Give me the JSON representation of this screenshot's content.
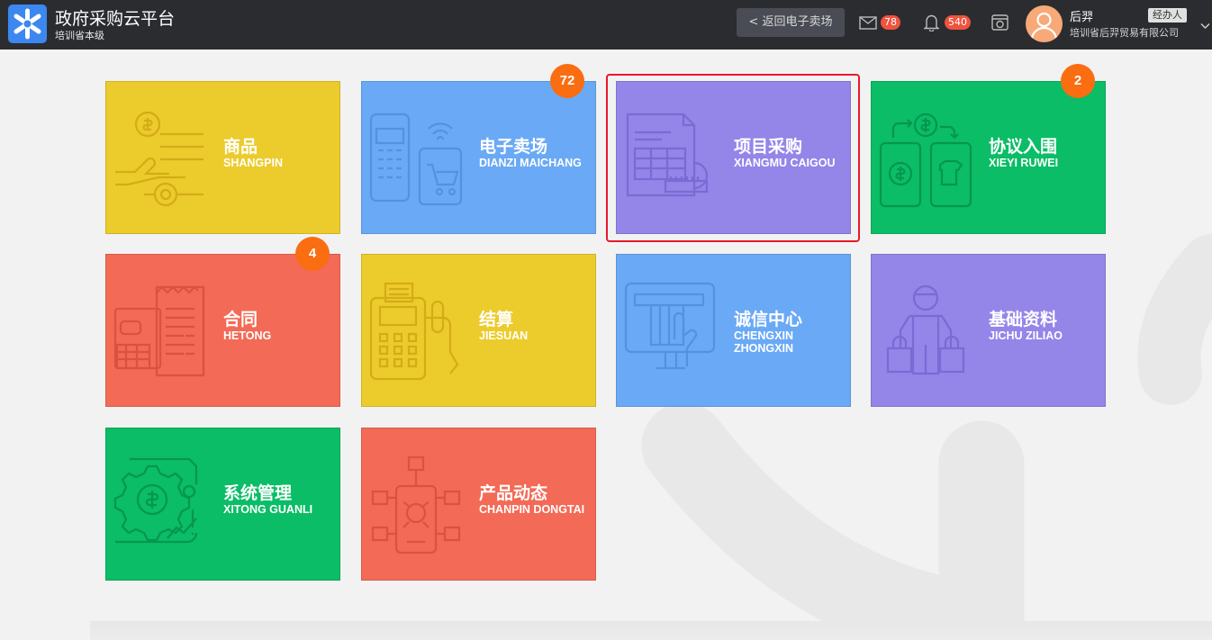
{
  "header": {
    "title": "政府采购云平台",
    "subtitle": "培训省本级",
    "back_label": "< 返回电子卖场",
    "mail_count": "78",
    "notify_count": "540",
    "user_name": "后羿",
    "user_role": "经办人",
    "company": "培训省后羿贸易有限公司"
  },
  "tiles": [
    {
      "cn": "商品",
      "en": "SHANGPIN",
      "color": "#eccb2c",
      "icon": "hand-coin-icon",
      "badge": ""
    },
    {
      "cn": "电子卖场",
      "en": "DIANZI MAICHANG",
      "color": "#6aa9f5",
      "icon": "phone-cart-icon",
      "badge": "72"
    },
    {
      "cn": "项目采购",
      "en": "XIANGMU CAIGOU",
      "color": "#9485e9",
      "icon": "purchase-document-icon",
      "badge": ""
    },
    {
      "cn": "协议入围",
      "en": "XIEYI RUWEI",
      "color": "#0abd66",
      "icon": "phone-exchange-icon",
      "badge": "2"
    },
    {
      "cn": "合同",
      "en": "HETONG",
      "color": "#f36a56",
      "icon": "contract-receipt-icon",
      "badge": "4"
    },
    {
      "cn": "结算",
      "en": "JIESUAN",
      "color": "#eccb2c",
      "icon": "pos-terminal-icon",
      "badge": ""
    },
    {
      "cn": "诚信中心",
      "en": "CHENGXIN ZHONGXIN",
      "color": "#6aa9f5",
      "icon": "atm-card-icon",
      "badge": ""
    },
    {
      "cn": "基础资料",
      "en": "JICHU ZILIAO",
      "color": "#9485e9",
      "icon": "person-bags-icon",
      "badge": ""
    },
    {
      "cn": "系统管理",
      "en": "XITONG GUANLI",
      "color": "#0abd66",
      "icon": "gear-dollar-icon",
      "badge": ""
    },
    {
      "cn": "产品动态",
      "en": "CHANPIN DONGTAI",
      "color": "#f36a56",
      "icon": "network-phone-icon",
      "badge": ""
    }
  ]
}
